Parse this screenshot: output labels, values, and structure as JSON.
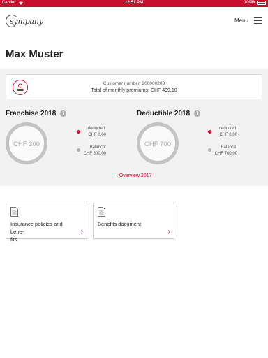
{
  "statusbar": {
    "carrier": "Carrier",
    "time": "12:51 PM",
    "battery": "100%"
  },
  "navbar": {
    "logo_text": "sympany",
    "menu_label": "Menu"
  },
  "page_title": "Max Muster",
  "customer": {
    "number_text": "Customer number: 200000203",
    "premiums_text": "Total of monthly premiums: CHF 499.10"
  },
  "franchise": {
    "title": "Franchise 2018",
    "gauge_value": "CHF 300",
    "deducted_label": "deducted:",
    "deducted_value": "CHF 0.00",
    "balance_label": "Balance:",
    "balance_value": "CHF 300.00"
  },
  "deductible": {
    "title": "Deductible 2018",
    "gauge_value": "CHF 700",
    "deducted_label": "deducted:",
    "deducted_value": "CHF 0.00",
    "balance_label": "Balance:",
    "balance_value": "CHF 700.00"
  },
  "overview_link": "Overview 2017",
  "documents": [
    {
      "label": "Insurance policies and bene-\nfits"
    },
    {
      "label": "Benefits document"
    }
  ],
  "colors": {
    "accent": "#c8102e",
    "gauge": "#c4c4c4",
    "deducted_dot": "#c8102e",
    "balance_dot": "#b0b0b0"
  },
  "icons": {
    "customer": "person-icon",
    "info": "info-icon",
    "document": "document-icon",
    "chevron": "chevron-right-icon",
    "menu": "hamburger-icon"
  }
}
